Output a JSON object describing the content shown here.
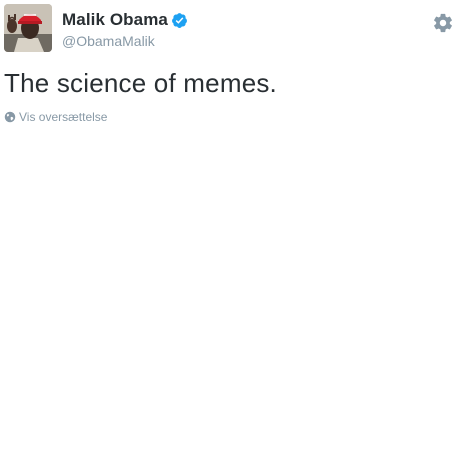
{
  "tweet": {
    "author": {
      "display_name": "Malik Obama",
      "handle": "@ObamaMalik",
      "verified": true,
      "avatar_icon": "profile-photo"
    },
    "text": "The science of memes.",
    "translate_label": "Vis oversættelse",
    "actions_icon": "gear-icon"
  },
  "colors": {
    "primary_text": "#292f33",
    "secondary_text": "#8899a6",
    "verified_badge": "#1da1f2",
    "gear": "#8899a6"
  }
}
